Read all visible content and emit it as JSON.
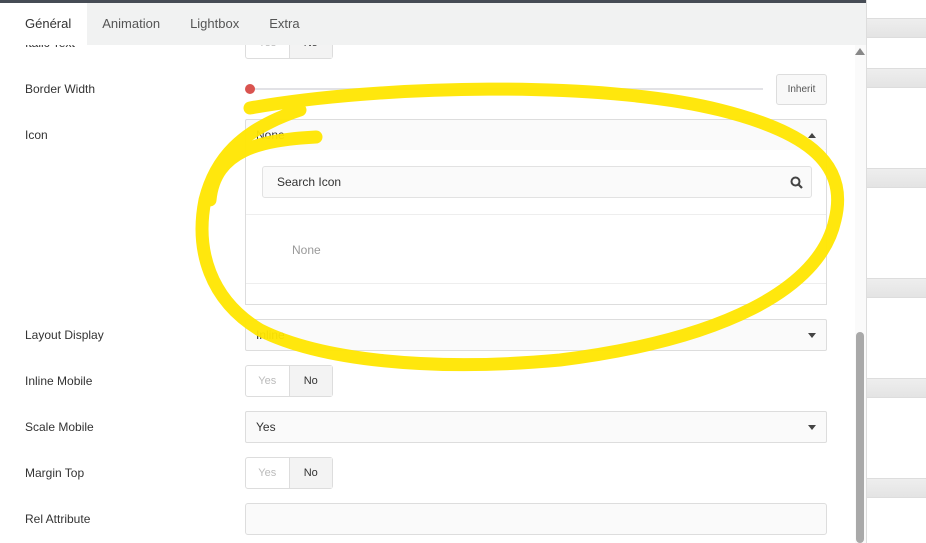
{
  "tabs": [
    "Général",
    "Animation",
    "Lightbox",
    "Extra"
  ],
  "fields": {
    "italic_text": {
      "label": "Italic Text",
      "yes": "Yes",
      "no": "No"
    },
    "border_width": {
      "label": "Border Width",
      "value": 0,
      "button": "Inherit"
    },
    "icon": {
      "label": "Icon",
      "value": "None",
      "search_placeholder": "Search Icon",
      "option": "None"
    },
    "layout_display": {
      "label": "Layout Display",
      "value": "Inline"
    },
    "inline_mobile": {
      "label": "Inline Mobile",
      "yes": "Yes",
      "no": "No"
    },
    "scale_mobile": {
      "label": "Scale Mobile",
      "value": "Yes"
    },
    "margin_top": {
      "label": "Margin Top",
      "yes": "Yes",
      "no": "No"
    },
    "rel_attribute": {
      "label": "Rel Attribute",
      "value": ""
    }
  },
  "annotation_color": "#ffe600"
}
